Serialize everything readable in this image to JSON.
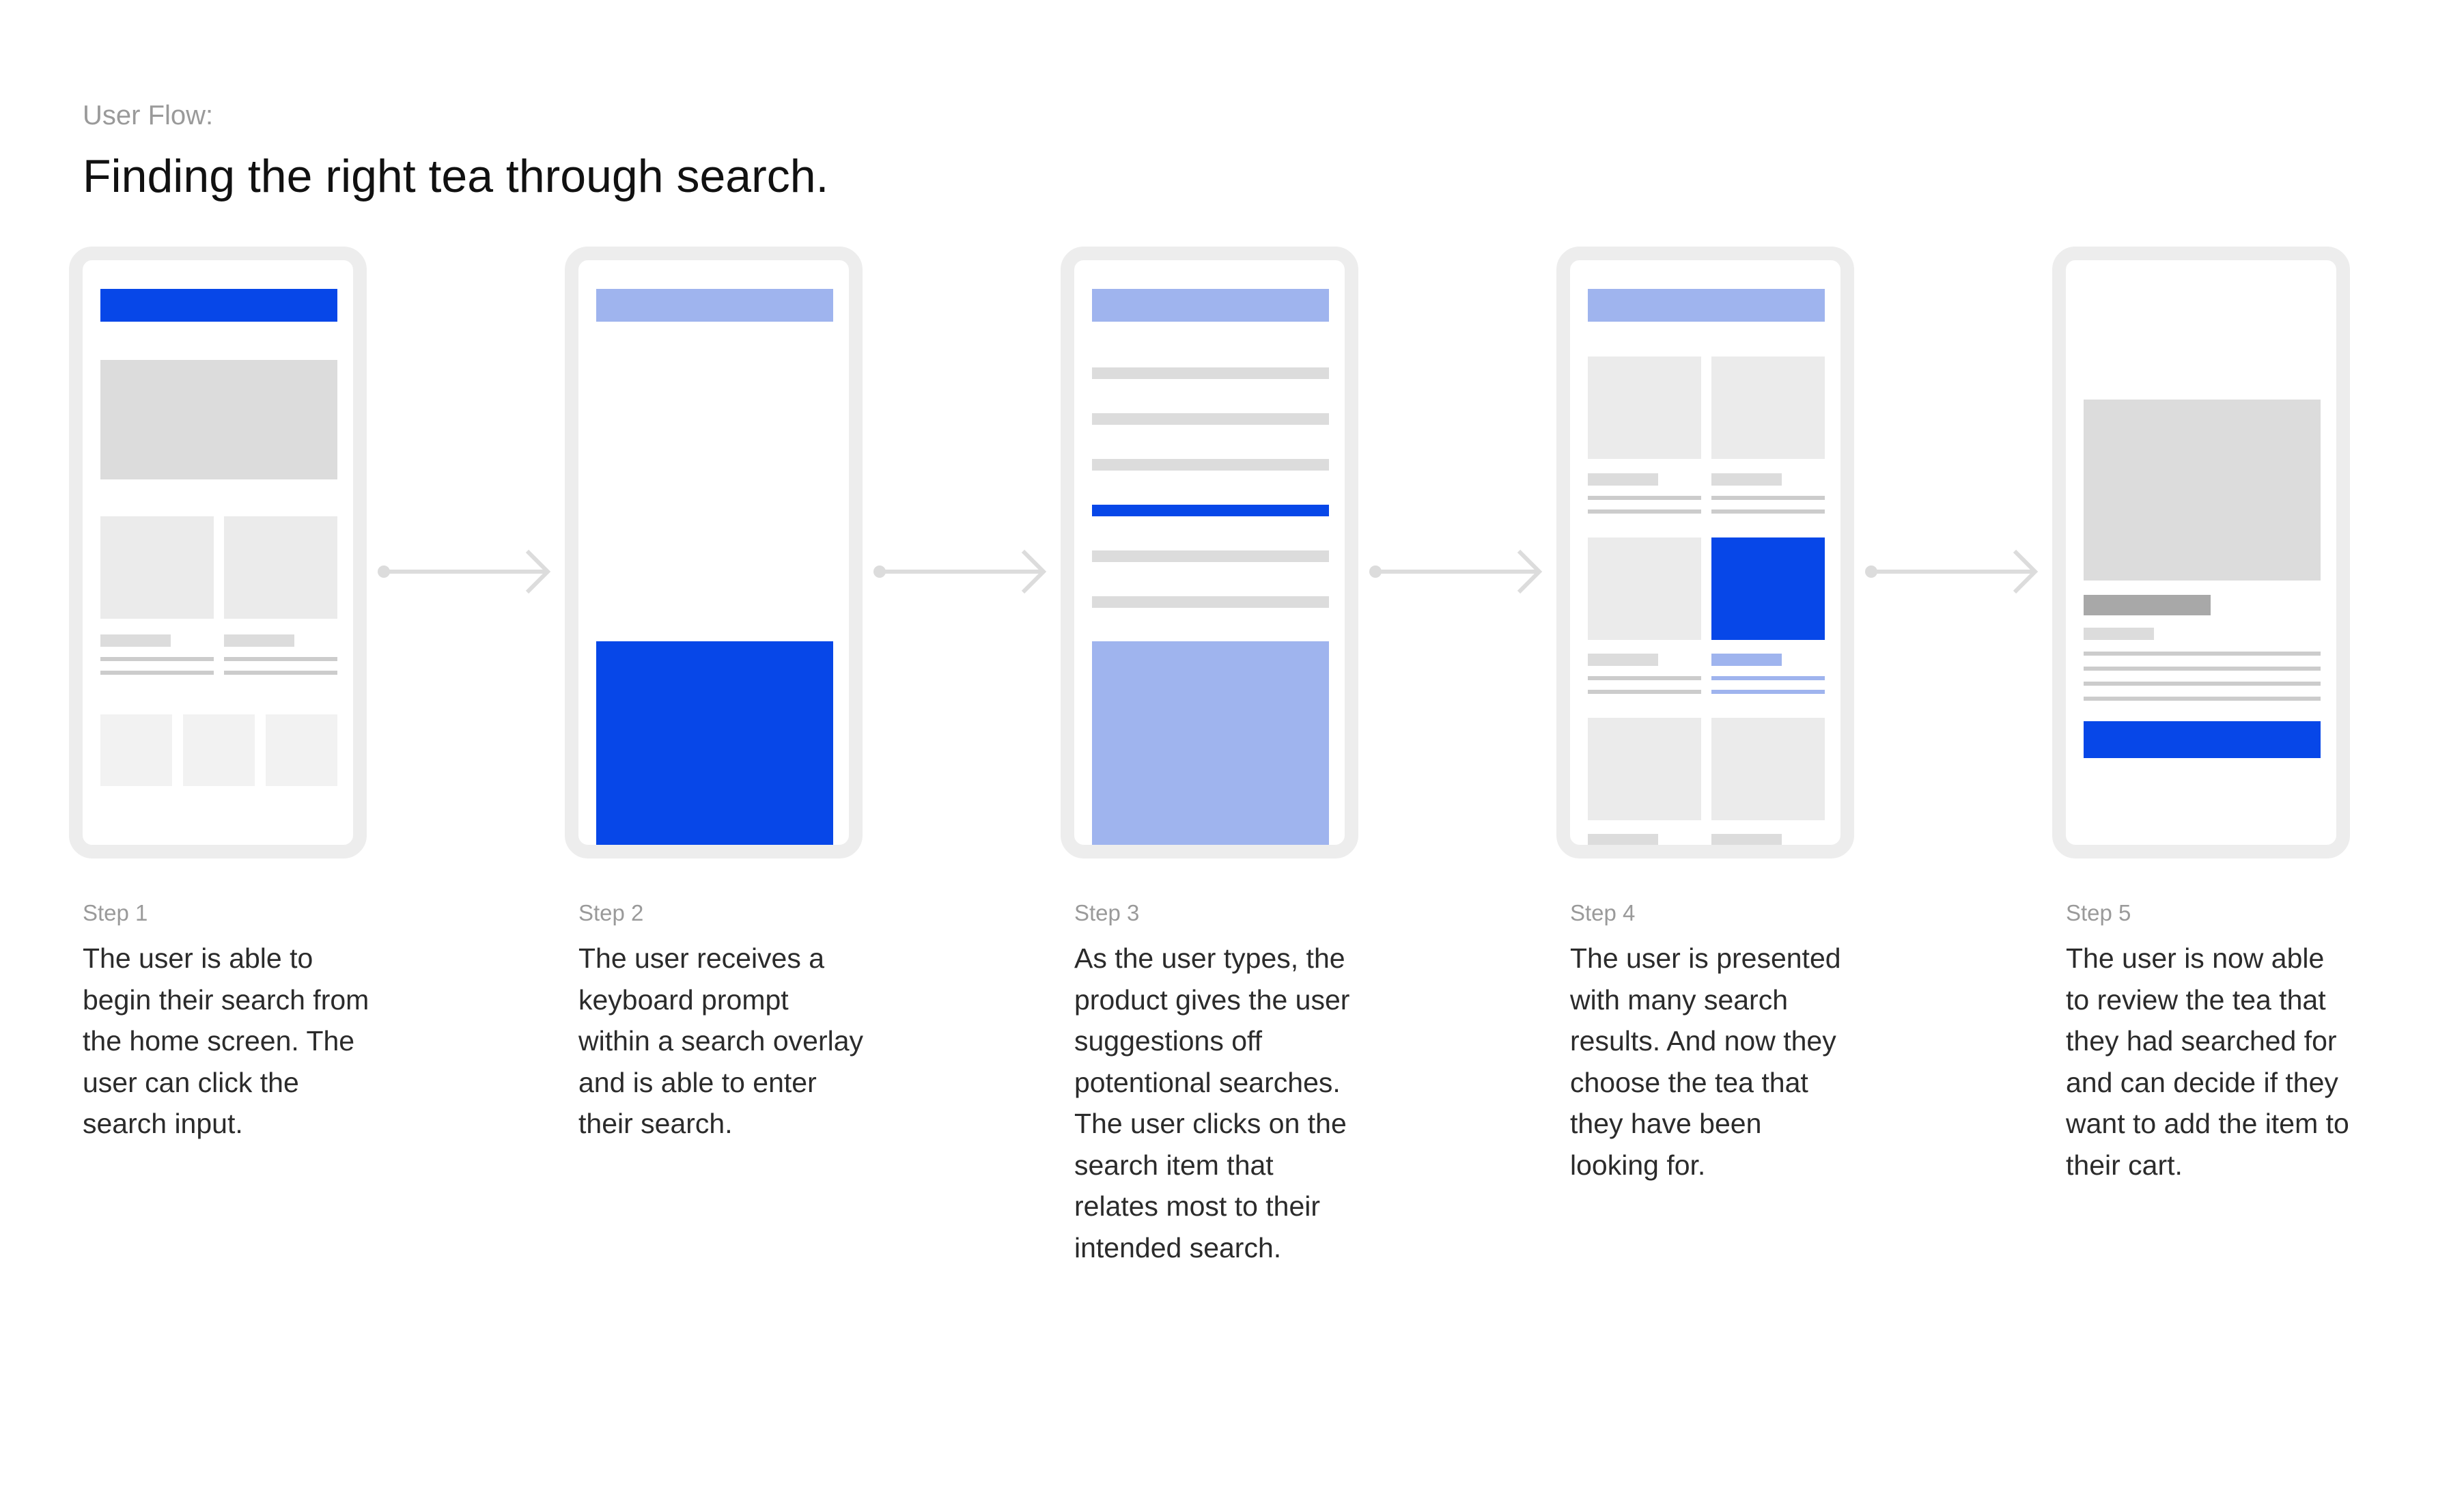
{
  "header": {
    "overline": "User Flow:",
    "title": "Finding the right tea through search."
  },
  "steps": [
    {
      "label": "Step 1",
      "text": "The user is able to begin their search from the home screen. The user can click the search input."
    },
    {
      "label": "Step 2",
      "text": "The user receives a keyboard prompt within a search overlay and is able to enter their search."
    },
    {
      "label": "Step 3",
      "text": "As the user types, the product gives the user suggestions off potentional searches. The user clicks on the search item that relates most to their intended search."
    },
    {
      "label": "Step 4",
      "text": "The user is presented with many search results. And now they choose the tea that they have been looking for."
    },
    {
      "label": "Step 5",
      "text": "The user is now able to review the tea that they had searched for and can decide if they want to add the item to their cart."
    }
  ],
  "colors": {
    "accent": "#0747e8",
    "accent_light": "#9fb4ee",
    "placeholder_gray": "#dcdcdc",
    "frame_gray": "#ededed"
  }
}
